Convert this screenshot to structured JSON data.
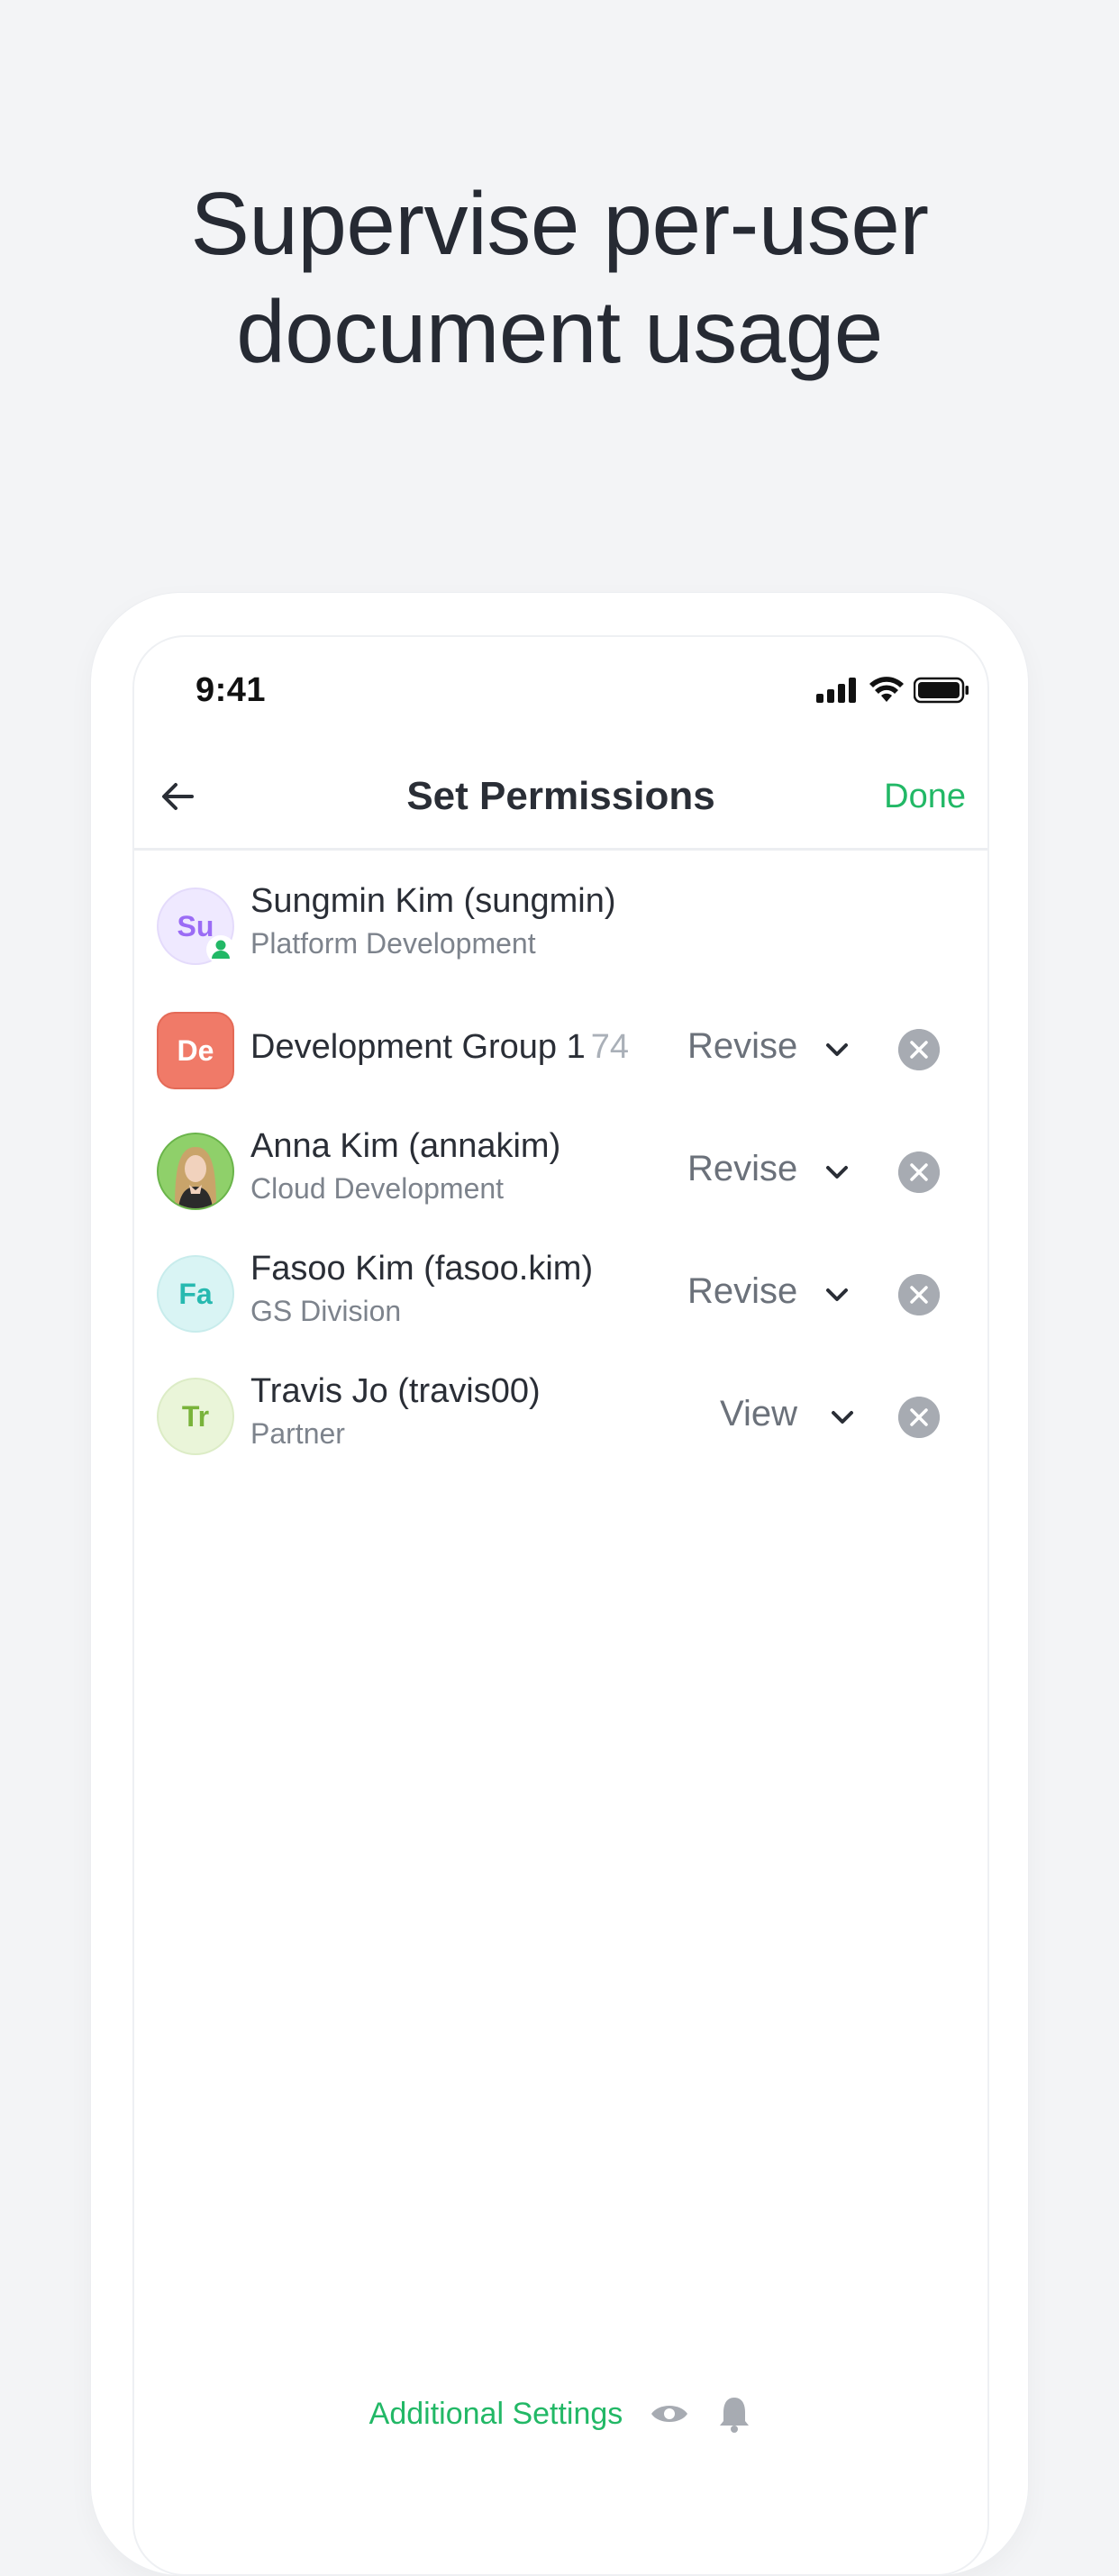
{
  "headline": {
    "line1": "Supervise per-user",
    "line2": "document usage"
  },
  "status_bar": {
    "time": "9:41"
  },
  "nav": {
    "title": "Set Permissions",
    "done_label": "Done"
  },
  "owner": {
    "initials": "Su",
    "name": "Sungmin Kim (sungmin)",
    "department": "Platform Development"
  },
  "members": [
    {
      "initials": "De",
      "name": "Development Group 1",
      "count": "74",
      "permission": "Revise",
      "avatar_color": "#f07a68"
    },
    {
      "name": "Anna Kim  (annakim)",
      "department": "Cloud Development",
      "permission": "Revise",
      "avatar_icon": "photo-avatar"
    },
    {
      "initials": "Fa",
      "name": "Fasoo Kim (fasoo.kim)",
      "department": "GS Division",
      "permission": "Revise",
      "avatar_color": "#d9f4f4"
    },
    {
      "initials": "Tr",
      "name": "Travis Jo (travis00)",
      "department": "Partner",
      "permission": "View",
      "avatar_color": "#eaf5d9"
    }
  ],
  "footer": {
    "additional_settings_label": "Additional Settings"
  },
  "colors": {
    "accent": "#22b866",
    "background": "#f3f4f6",
    "remove": "#a7abb2"
  }
}
